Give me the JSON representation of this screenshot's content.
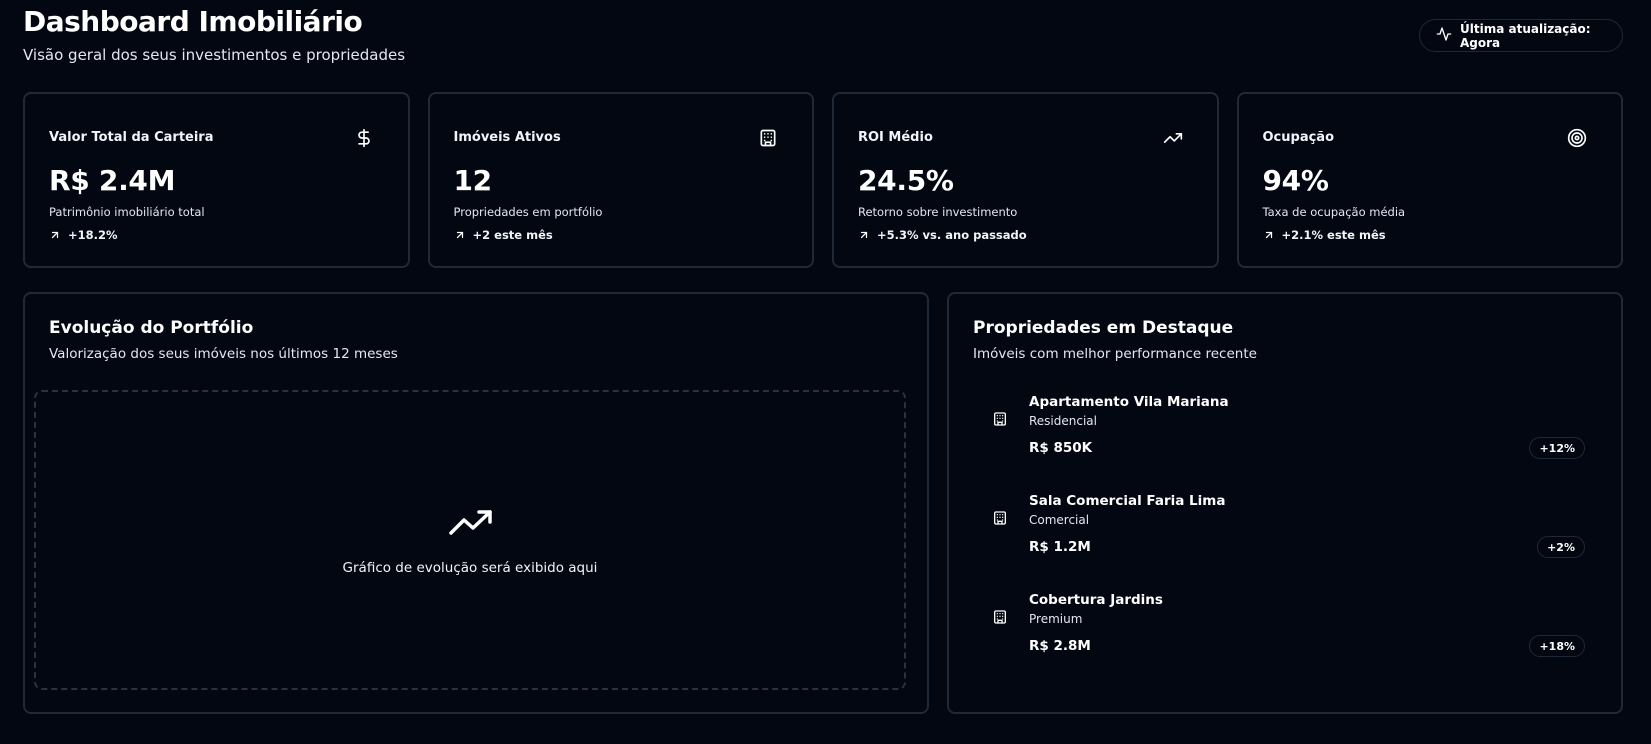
{
  "header": {
    "title": "Dashboard Imobiliário",
    "subtitle": "Visão geral dos seus investimentos e propriedades",
    "update_label": "Última atualização: Agora",
    "update_icon": "activity-icon"
  },
  "stats": [
    {
      "label": "Valor Total da Carteira",
      "icon": "dollar-icon",
      "value": "R$ 2.4M",
      "description": "Patrimônio imobiliário total",
      "change": "+18.2%"
    },
    {
      "label": "Imóveis Ativos",
      "icon": "building-icon",
      "value": "12",
      "description": "Propriedades em portfólio",
      "change": "+2 este mês"
    },
    {
      "label": "ROI Médio",
      "icon": "trending-up-icon",
      "value": "24.5%",
      "description": "Retorno sobre investimento",
      "change": "+5.3% vs. ano passado"
    },
    {
      "label": "Ocupação",
      "icon": "target-icon",
      "value": "94%",
      "description": "Taxa de ocupação média",
      "change": "+2.1% este mês"
    }
  ],
  "evolution": {
    "title": "Evolução do Portfólio",
    "subtitle": "Valorização dos seus imóveis nos últimos 12 meses",
    "placeholder_text": "Gráfico de evolução será exibido aqui",
    "placeholder_icon": "trending-up-icon"
  },
  "featured": {
    "title": "Propriedades em Destaque",
    "subtitle": "Imóveis com melhor performance recente",
    "items": [
      {
        "name": "Apartamento Vila Mariana",
        "type": "Residencial",
        "value": "R$ 850K",
        "change": "+12%"
      },
      {
        "name": "Sala Comercial Faria Lima",
        "type": "Comercial",
        "value": "R$ 1.2M",
        "change": "+2%"
      },
      {
        "name": "Cobertura Jardins",
        "type": "Premium",
        "value": "R$ 2.8M",
        "change": "+18%"
      }
    ]
  },
  "colors": {
    "background": "#030712",
    "border": "#1f2937",
    "text": "#f8fafc"
  }
}
